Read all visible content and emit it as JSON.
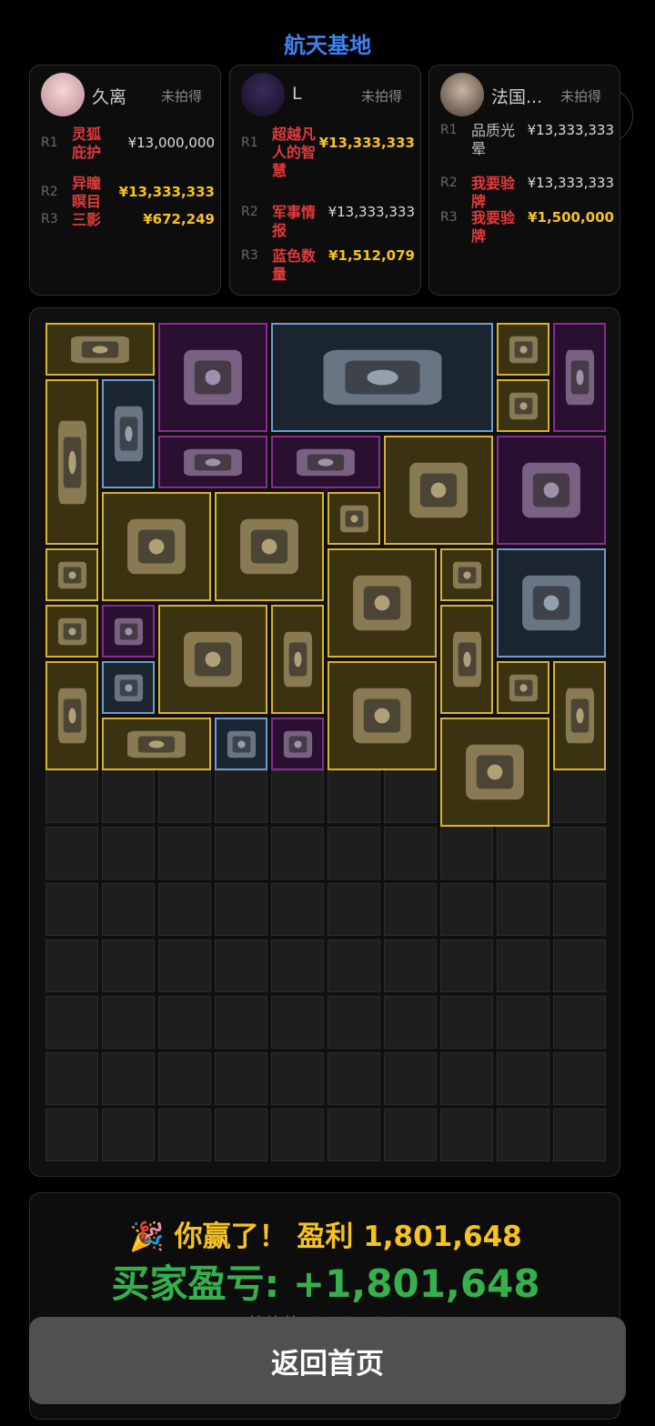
{
  "map_title": "航天基地",
  "players": [
    {
      "name": "久离",
      "status": "未拍得",
      "rounds": [
        {
          "label": "R1",
          "item": "灵狐庇护",
          "price": "¥13,000,000",
          "highlight": false
        },
        {
          "label": "R2",
          "item": "异瞳瞑目",
          "price": "¥13,333,333",
          "highlight": true
        },
        {
          "label": "R3",
          "item": "三影",
          "price": "¥672,249",
          "highlight": true
        }
      ]
    },
    {
      "name": "L",
      "status": "未拍得",
      "rounds": [
        {
          "label": "R1",
          "item": "超越凡人的智慧",
          "price": "¥13,333,333",
          "highlight": true
        },
        {
          "label": "R2",
          "item": "军事情报",
          "price": "¥13,333,333",
          "highlight": false
        },
        {
          "label": "R3",
          "item": "蓝色数量",
          "price": "¥1,512,079",
          "highlight": true
        }
      ]
    },
    {
      "name": "法国...",
      "status": "未拍得",
      "rounds": [
        {
          "label": "R1",
          "item": "品质光晕",
          "price": "¥13,333,333",
          "highlight": false
        },
        {
          "label": "R2",
          "item": "我要验牌",
          "price": "¥13,333,333",
          "highlight": false
        },
        {
          "label": "R3",
          "item": "我要验牌",
          "price": "¥1,500,000",
          "highlight": true
        }
      ]
    }
  ],
  "items": [
    {
      "icon": "radio-transceiver-icon",
      "rarity": "gold"
    },
    {
      "icon": "centrifuge-icon",
      "rarity": "purple"
    },
    {
      "icon": "solar-panel-icon",
      "rarity": "blue"
    },
    {
      "icon": "scale-device-icon",
      "rarity": "gold"
    },
    {
      "icon": "gingerbread-man-icon",
      "rarity": "purple"
    },
    {
      "icon": "oxygen-tank-icon",
      "rarity": "gold"
    },
    {
      "icon": "coffee-grinder-icon",
      "rarity": "blue"
    },
    {
      "icon": "gas-filter-icon",
      "rarity": "gold"
    },
    {
      "icon": "edc-kit-icon",
      "rarity": "purple"
    },
    {
      "icon": "camera-lens-icon",
      "rarity": "purple"
    },
    {
      "icon": "neural-headset-icon",
      "rarity": "gold"
    },
    {
      "icon": "circular-saw-icon",
      "rarity": "purple"
    },
    {
      "icon": "binoculars-icon",
      "rarity": "gold"
    },
    {
      "icon": "neural-headset-icon",
      "rarity": "gold"
    },
    {
      "icon": "lighter-icon",
      "rarity": "gold"
    },
    {
      "icon": "medal-icon",
      "rarity": "gold"
    },
    {
      "icon": "cable-reel-icon",
      "rarity": "gold"
    },
    {
      "icon": "floppy-disk-icon",
      "rarity": "gold"
    },
    {
      "icon": "drone-icon",
      "rarity": "blue"
    },
    {
      "icon": "circuit-board-icon",
      "rarity": "gold"
    },
    {
      "icon": "keychain-icon",
      "rarity": "purple"
    },
    {
      "icon": "neural-headset-icon",
      "rarity": "gold"
    },
    {
      "icon": "figurine-icon",
      "rarity": "gold"
    },
    {
      "icon": "coffee-bag-icon",
      "rarity": "gold"
    },
    {
      "icon": "book-icon",
      "rarity": "gold"
    },
    {
      "icon": "thermometer-gun-icon",
      "rarity": "blue"
    },
    {
      "icon": "supply-crate-icon",
      "rarity": "gold"
    },
    {
      "icon": "teacup-icon",
      "rarity": "gold"
    },
    {
      "icon": "glass-column-icon",
      "rarity": "gold"
    },
    {
      "icon": "radio-transceiver-icon",
      "rarity": "gold"
    },
    {
      "icon": "card-pack-icon",
      "rarity": "blue"
    },
    {
      "icon": "ufo-stone-icon",
      "rarity": "purple"
    },
    {
      "icon": "cable-reel-icon",
      "rarity": "gold"
    }
  ],
  "result": {
    "win_text": "🎉 你赢了！ 盈利 1,801,648",
    "buyer_profit": "买家盈亏: +1,801,648",
    "total_value": "总价值: 3,801,648"
  },
  "home_button": "返回首页"
}
